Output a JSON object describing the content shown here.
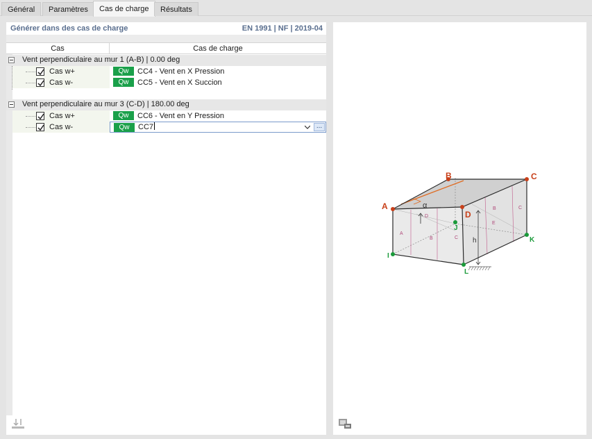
{
  "tabs": [
    {
      "label": "Général",
      "active": false
    },
    {
      "label": "Paramètres",
      "active": false
    },
    {
      "label": "Cas de charge",
      "active": true
    },
    {
      "label": "Résultats",
      "active": false
    }
  ],
  "section": {
    "title": "Générer dans des cas de charge",
    "norm": "EN 1991 | NF | 2019-04"
  },
  "table": {
    "col_cas": "Cas",
    "col_cas_charge": "Cas de charge",
    "groups": [
      {
        "label": "Vent perpendiculaire au mur 1 (A-B) | 0.00 deg",
        "rows": [
          {
            "cas": "Cas w+",
            "badge": "Qw",
            "load_case": "CC4 - Vent en X Pression",
            "checked": true
          },
          {
            "cas": "Cas w-",
            "badge": "Qw",
            "load_case": "CC5 - Vent en X Succion",
            "checked": true
          }
        ]
      },
      {
        "label": "Vent perpendiculaire au mur 3 (C-D) | 180.00 deg",
        "rows": [
          {
            "cas": "Cas w+",
            "badge": "Qw",
            "load_case": "CC6 - Vent en Y Pression",
            "checked": true
          },
          {
            "cas": "Cas w-",
            "badge": "Qw",
            "load_case": "CC7",
            "checked": true,
            "editing": true,
            "ellipsis": "..."
          }
        ]
      }
    ]
  },
  "diagram": {
    "points": {
      "A": "A",
      "B": "B",
      "C": "C",
      "D": "D",
      "I": "I",
      "J": "J",
      "K": "K",
      "L": "L"
    },
    "zones": {
      "a": "A",
      "b": "B",
      "c": "C",
      "d": "D",
      "e": "E"
    },
    "alpha": "α",
    "h": "h"
  },
  "colors": {
    "badge": "#1aa04a",
    "point_red": "#c8401a",
    "point_green": "#1a9a3a",
    "zone_label": "#b04a7a"
  },
  "icons": {
    "left_bottom": "export-icon",
    "right_bottom": "print-image-icon"
  }
}
